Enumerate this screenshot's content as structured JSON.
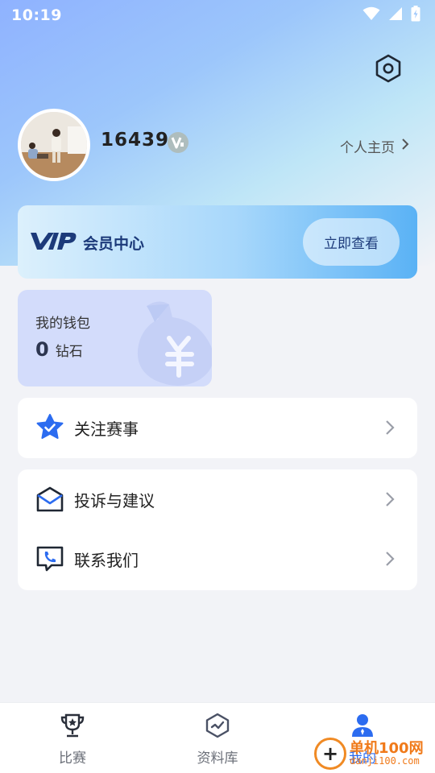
{
  "status_bar": {
    "time": "10:19"
  },
  "profile": {
    "username": "16439",
    "badge": "V",
    "homepage_label": "个人主页"
  },
  "vip": {
    "logo": "VIP",
    "title": "会员中心",
    "button": "立即查看"
  },
  "wallet": {
    "title": "我的钱包",
    "amount": "0",
    "unit": "钻石"
  },
  "menu": {
    "follow": "关注赛事",
    "feedback": "投诉与建议",
    "contact": "联系我们"
  },
  "nav": {
    "matches": "比赛",
    "library": "资料库",
    "mine": "我的"
  },
  "watermark": {
    "line1": "单机100网",
    "line2": "danji100.com"
  },
  "colors": {
    "accent": "#2c6cf0",
    "vip_text": "#1c3a7a",
    "wallet_bg": "#d3dcfb"
  }
}
